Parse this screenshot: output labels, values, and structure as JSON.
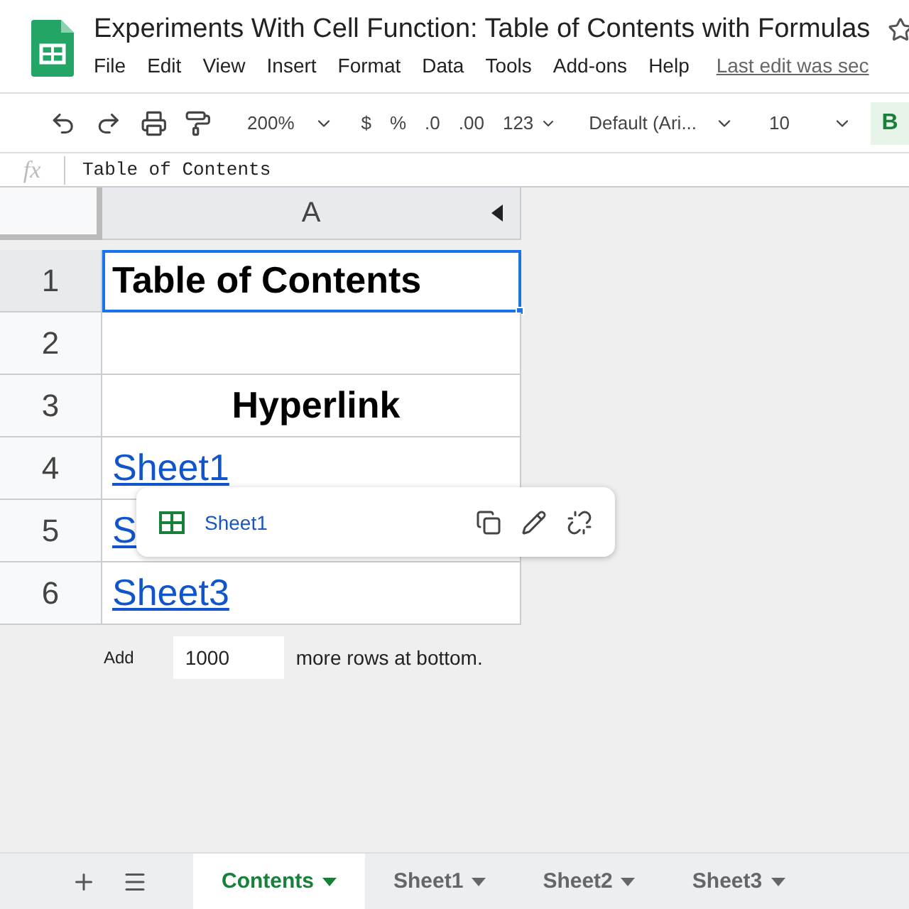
{
  "doc_title": "Experiments With Cell Function: Table of Contents with Formulas",
  "menu": [
    "File",
    "Edit",
    "View",
    "Insert",
    "Format",
    "Data",
    "Tools",
    "Add-ons",
    "Help"
  ],
  "last_edit": "Last edit was sec",
  "toolbar": {
    "zoom": "200%",
    "currency": "$",
    "percent": "%",
    "dec_less": ".0",
    "dec_more": ".00",
    "format": "123",
    "font": "Default (Ari...",
    "size": "10",
    "bold": "B",
    "bold_on": true
  },
  "formula": {
    "fx": "fx",
    "value": "Table of Contents"
  },
  "column": "A",
  "rows": [
    {
      "num": "1",
      "kind": "title",
      "text": "Table of Contents",
      "selected": true
    },
    {
      "num": "2",
      "kind": "empty",
      "selected": false
    },
    {
      "num": "3",
      "kind": "header",
      "text": "Hyperlink",
      "selected": false
    },
    {
      "num": "4",
      "kind": "link",
      "text": "Sheet1",
      "selected": false
    },
    {
      "num": "5",
      "kind": "link",
      "text": "S",
      "selected": false
    },
    {
      "num": "6",
      "kind": "link",
      "text": "Sheet3",
      "selected": false
    }
  ],
  "popup": {
    "link": "Sheet1"
  },
  "add_rows": {
    "button": "Add",
    "value": "1000",
    "suffix": "more rows at bottom."
  },
  "sheets": [
    {
      "label": "Contents",
      "selected": true
    },
    {
      "label": "Sheet1",
      "selected": false
    },
    {
      "label": "Sheet2",
      "selected": false
    },
    {
      "label": "Sheet3",
      "selected": false
    }
  ]
}
